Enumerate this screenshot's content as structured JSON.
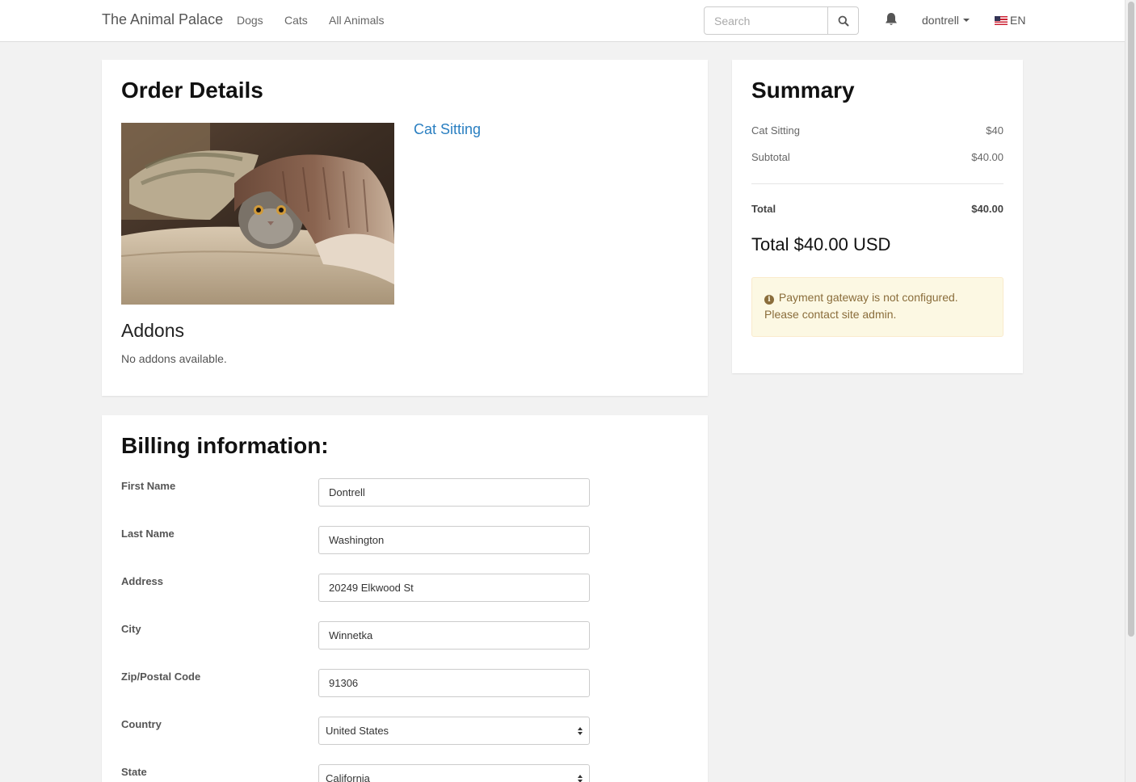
{
  "navbar": {
    "brand": "The Animal Palace",
    "links": [
      "Dogs",
      "Cats",
      "All Animals"
    ],
    "search_placeholder": "Search",
    "user": "dontrell",
    "language": "EN"
  },
  "order": {
    "title": "Order Details",
    "product_name": "Cat Sitting",
    "addons_title": "Addons",
    "addons_text": "No addons available."
  },
  "summary": {
    "title": "Summary",
    "item_label": "Cat Sitting",
    "item_price": "$40",
    "subtotal_label": "Subtotal",
    "subtotal_value": "$40.00",
    "total_label": "Total",
    "total_value": "$40.00",
    "total_big": "Total $40.00 USD",
    "alert": "Payment gateway is not configured. Please contact site admin."
  },
  "billing": {
    "title": "Billing information:",
    "first_name_label": "First Name",
    "first_name": "Dontrell",
    "last_name_label": "Last Name",
    "last_name": "Washington",
    "address_label": "Address",
    "address": "20249 Elkwood St",
    "city_label": "City",
    "city": "Winnetka",
    "zip_label": "Zip/Postal Code",
    "zip": "91306",
    "country_label": "Country",
    "country": "United States",
    "state_label": "State",
    "state": "California"
  },
  "colors": {
    "link": "#2a7fc1",
    "alert_bg": "#fcf8e3",
    "alert_text": "#8a6d3b",
    "page_bg": "#f2f2f2"
  }
}
